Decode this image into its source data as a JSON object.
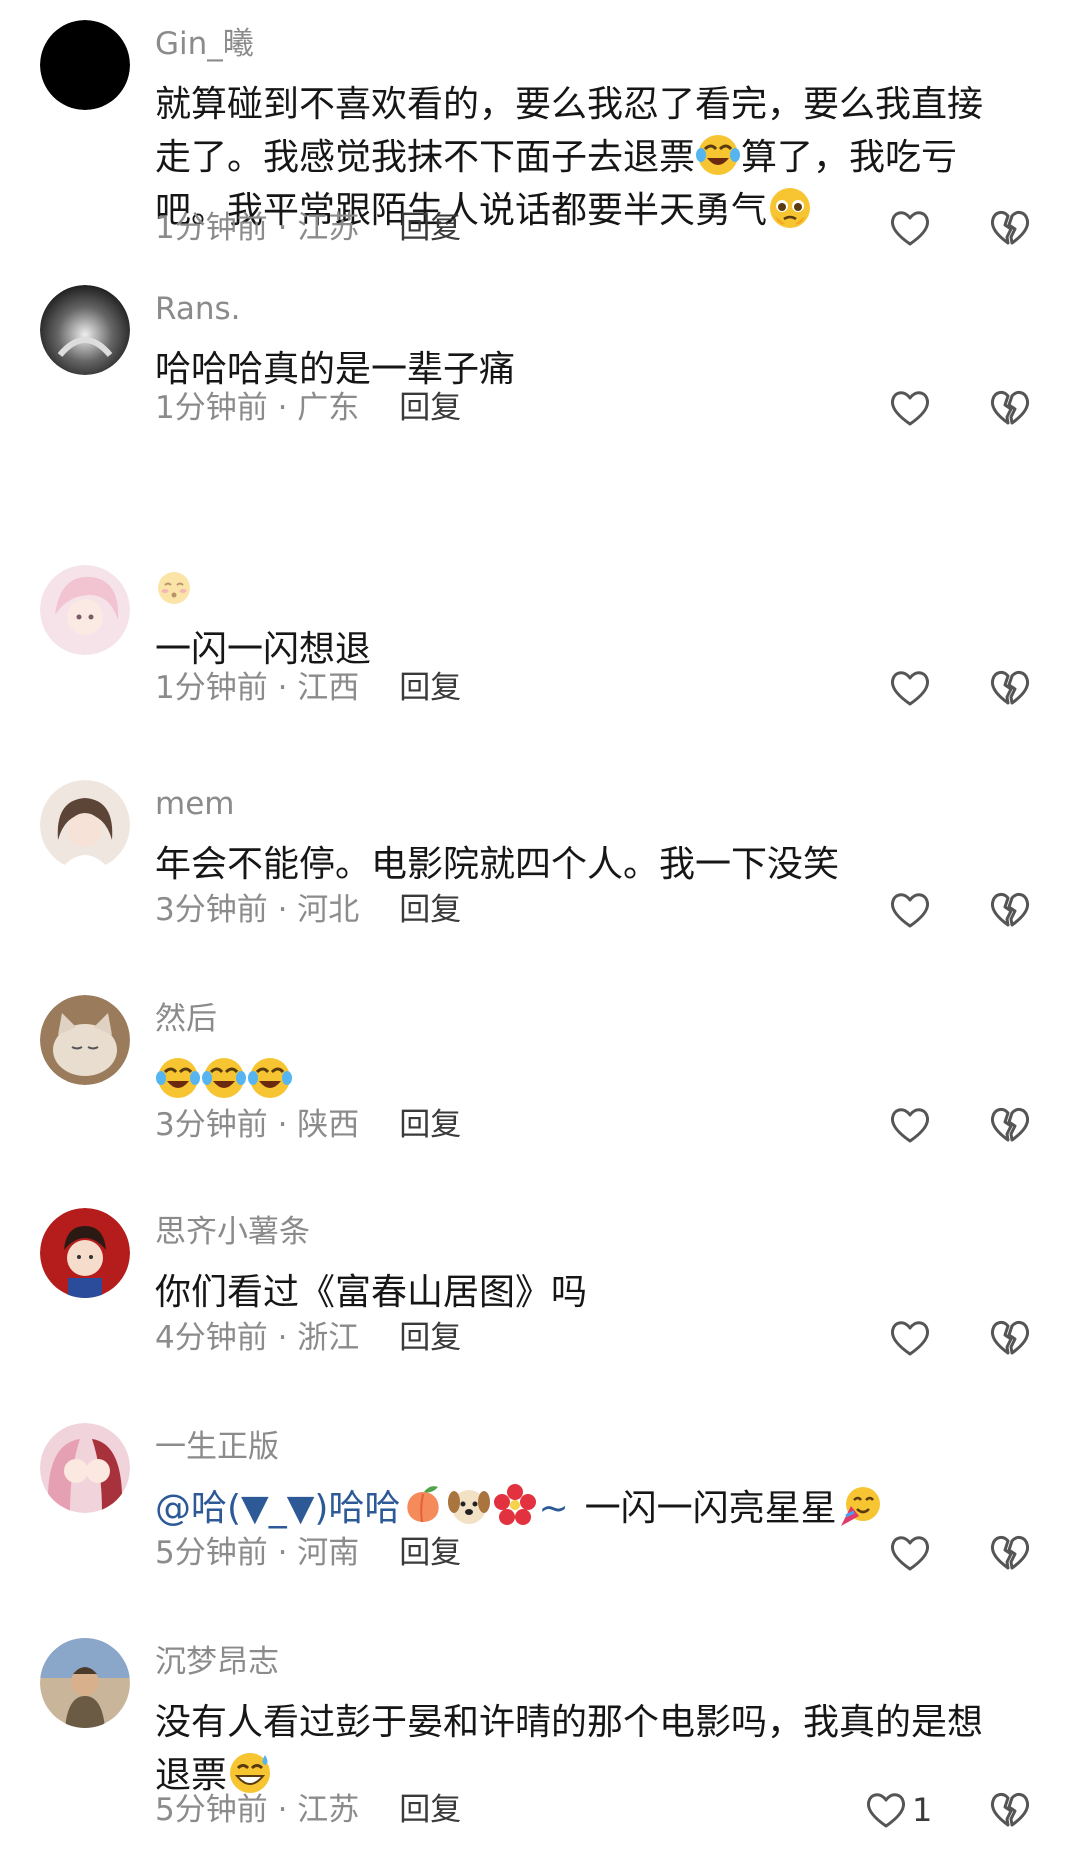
{
  "comments": [
    {
      "username": "Gin_曦",
      "text_parts": [
        "就算碰到不喜欢看的，要么我忍了看完，要么我直接走了。我感觉我抹不下面子去退票",
        "算了，我吃亏吧。我平常跟陌生人说话都要半天勇气"
      ],
      "emojis": [
        "crying-laughing-emoji",
        "pleading-face-emoji"
      ],
      "time": "1分钟前",
      "location": "江苏",
      "reply_label": "回复",
      "likes": ""
    },
    {
      "username": "Rans.",
      "text": "哈哈哈真的是一辈子痛",
      "time": "1分钟前",
      "location": "广东",
      "reply_label": "回复",
      "likes": ""
    },
    {
      "username_emoji": "blushing-face-emoji",
      "text": "一闪一闪想退",
      "time": "1分钟前",
      "location": "江西",
      "reply_label": "回复",
      "likes": ""
    },
    {
      "username": "mem",
      "text": "年会不能停。电影院就四个人。我一下没笑",
      "time": "3分钟前",
      "location": "河北",
      "reply_label": "回复",
      "likes": ""
    },
    {
      "username": "然后",
      "emojis": [
        "crying-laughing-emoji",
        "crying-laughing-emoji",
        "crying-laughing-emoji"
      ],
      "time": "3分钟前",
      "location": "陕西",
      "reply_label": "回复",
      "likes": ""
    },
    {
      "username": "思齐小薯条",
      "text": "你们看过《富春山居图》吗",
      "time": "4分钟前",
      "location": "浙江",
      "reply_label": "回复",
      "likes": ""
    },
    {
      "username": "一生正版",
      "mention": "@哈(▼_▼)哈哈",
      "mention_emojis": [
        "peach-emoji",
        "dog-face-emoji",
        "hibiscus-emoji"
      ],
      "mention_suffix": "~",
      "text": "一闪一闪亮星星",
      "emojis": [
        "party-face-emoji"
      ],
      "time": "5分钟前",
      "location": "河南",
      "reply_label": "回复",
      "likes": ""
    },
    {
      "username": "沉梦昂志",
      "text_parts": [
        "没有人看过彭于晏和许晴的那个电影吗，我真的是想退票"
      ],
      "emojis": [
        "grinning-sweat-emoji"
      ],
      "time": "5分钟前",
      "location": "江苏",
      "reply_label": "回复",
      "likes": "1"
    }
  ],
  "separator": " · ",
  "colors": {
    "text": "#161616",
    "secondary": "#8b8b8b",
    "mention": "#2d5a97"
  }
}
